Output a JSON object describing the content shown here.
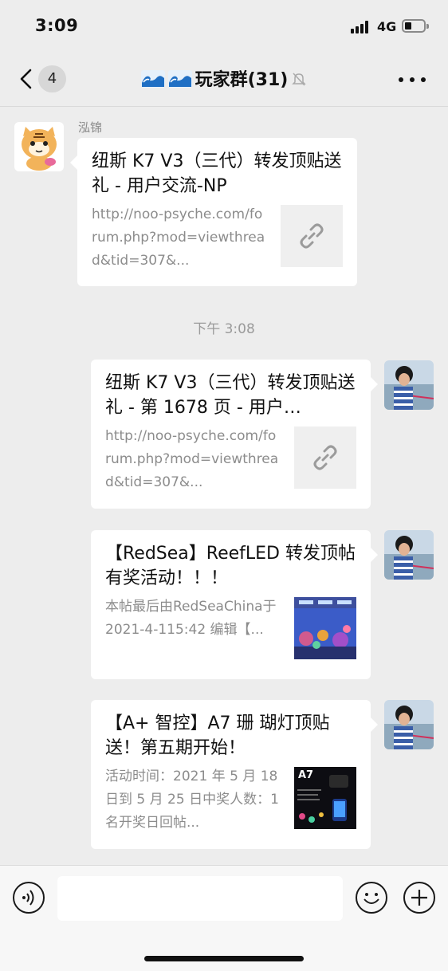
{
  "status_bar": {
    "time": "3:09",
    "network": "4G",
    "battery_level": 0.3
  },
  "nav": {
    "back_icon": "chevron-left-icon",
    "unread_count": "4",
    "title_emoji": "water-wave-icon",
    "title": "玩家群(31)",
    "mute_icon": "bell-slash-icon",
    "more_icon": "ellipsis-icon"
  },
  "messages": {
    "msg1": {
      "sender": "泓锦",
      "avatar": "tiger-cartoon-avatar",
      "title": "纽斯 K7 V3（三代）转发顶贴送礼 - 用户交流-NP",
      "desc": "http://noo-psyche.com/forum.php?mod=viewthread&tid=307&...",
      "thumb_icon": "link-icon"
    },
    "timestamp": "下午 3:08",
    "msg2": {
      "avatar": "child-photo-avatar",
      "title": "纽斯 K7 V3（三代）转发顶贴送礼 - 第 1678 页 - 用户…",
      "desc": "http://noo-psyche.com/forum.php?mod=viewthread&tid=307&...",
      "thumb_icon": "link-icon"
    },
    "msg3": {
      "avatar": "child-photo-avatar",
      "title": "【RedSea】ReefLED 转发顶帖有奖活动！！！",
      "desc": "本帖最后由RedSeaChina于 2021-4-115:42 编辑【...",
      "thumb_icon": "aquarium-thumbnail"
    },
    "msg4": {
      "avatar": "child-photo-avatar",
      "title": "【A+ 智控】A7 珊 瑚灯顶贴送！第五期开始！",
      "desc": "活动时间：2021 年 5 月 18 日到 5 月 25 日中奖人数：1 名开奖日回帖...",
      "thumb_icon": "product-thumbnail",
      "thumb_label": "A7"
    }
  },
  "input_bar": {
    "voice_icon": "voice-icon",
    "input_value": "",
    "emoji_icon": "smiley-icon",
    "plus_icon": "plus-icon"
  }
}
